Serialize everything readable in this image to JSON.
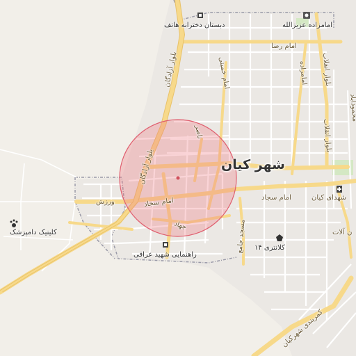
{
  "map": {
    "city": "شهر کیان",
    "roads": {
      "azadegan": "بلوار آزادگان",
      "azadegan2": "بلوار آزادگان",
      "emam_reza": "امام رضا",
      "khomeini": "امام خمینی",
      "enghelab": "بلوار انقلاب",
      "emamzadeh": "امامزاده",
      "nasr": "ناصر",
      "sajjad_east": "امام سجاد",
      "sajjad_west": "امام سجاد",
      "jahad": "جهاد",
      "masjed_jame": "مسجد جامع",
      "varzesh": "ورزش",
      "shohada": "شهدای کیان",
      "mahmoudabad": "محمودآباد",
      "kamarbandi": "کمربندی شهرکیان",
      "alat": "ن آلات"
    },
    "pois": {
      "school": "دبستان دخترانه هاتف",
      "shrine": "امامزاده عزیزالله",
      "clinic": "کلینیک دامپزشک",
      "police": "کلانتری ۱۴",
      "rahnamaei": "راهنمایی شهید عراقی"
    },
    "icons": [
      "school-icon",
      "shrine-icon",
      "paw-icon",
      "police-icon",
      "school-icon",
      "hospital-icon"
    ]
  }
}
